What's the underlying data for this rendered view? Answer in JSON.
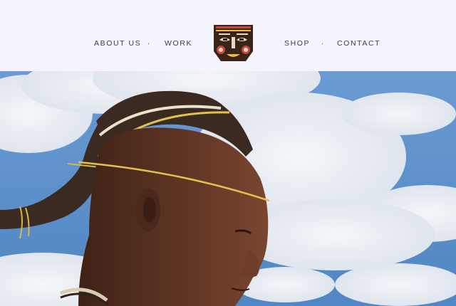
{
  "nav": {
    "items": [
      {
        "label": "ABOUT US"
      },
      {
        "label": "WORK"
      },
      {
        "label": "SHOP"
      },
      {
        "label": "CONTACT"
      }
    ],
    "separator": "."
  },
  "logo": {
    "icon": "tribal-mask-icon",
    "colors": {
      "base": "#3a2418",
      "accent_red": "#c8463a",
      "accent_yellow": "#e8b84a",
      "face_light": "#e9d9c0"
    }
  },
  "hero": {
    "image": "portrait-photo-of-person-with-traditional-braided-headdress",
    "colors": {
      "sky": "#5b8fc8",
      "cloud": "#e8ecf2",
      "skin": "#5a3322",
      "hair": "#3a2a22",
      "band": "#e2c24a"
    }
  }
}
